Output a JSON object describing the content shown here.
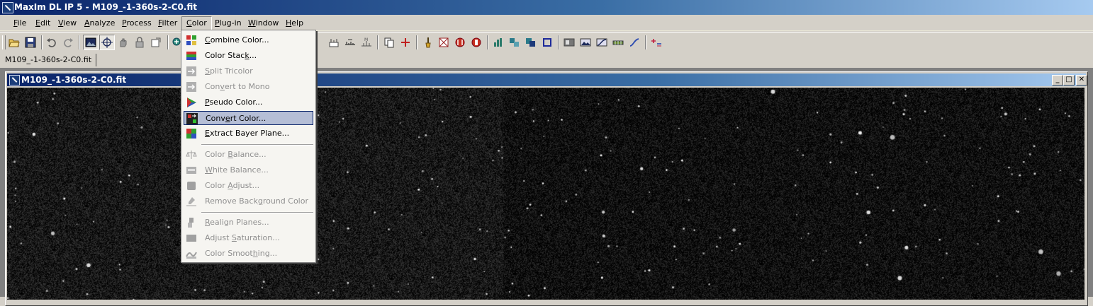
{
  "window": {
    "title": "MaxIm DL IP 5 - M109_-1-360s-2-C0.fit"
  },
  "menubar": [
    {
      "label": "File",
      "accel": "F",
      "rest": "ile"
    },
    {
      "label": "Edit",
      "accel": "E",
      "rest": "dit"
    },
    {
      "label": "View",
      "accel": "V",
      "rest": "iew"
    },
    {
      "label": "Analyze",
      "accel": "A",
      "rest": "nalyze"
    },
    {
      "label": "Process",
      "accel": "P",
      "rest": "rocess"
    },
    {
      "label": "Filter",
      "accel": "F",
      "rest": "ilter"
    },
    {
      "label": "Color",
      "accel": "C",
      "rest": "olor"
    },
    {
      "label": "Plug-in",
      "accel": "P",
      "rest": "lug-in"
    },
    {
      "label": "Window",
      "accel": "W",
      "rest": "indow"
    },
    {
      "label": "Help",
      "accel": "H",
      "rest": "elp"
    }
  ],
  "tabstrip": {
    "doc_tab": "M109_-1-360s-2-C0.fit"
  },
  "child_window": {
    "title": "M109_-1-360s-2-C0.fit",
    "min": "_",
    "max": "□",
    "close": "✕"
  },
  "color_menu": {
    "items": [
      {
        "pre": "",
        "accel": "C",
        "post": "ombine Color...",
        "enabled": true,
        "icon": "combine-color-icon"
      },
      {
        "pre": "Color Stac",
        "accel": "k",
        "post": "...",
        "enabled": true,
        "icon": "color-stack-icon"
      },
      {
        "pre": "",
        "accel": "S",
        "post": "plit Tricolor",
        "enabled": false,
        "icon": "split-tricolor-icon"
      },
      {
        "pre": "Con",
        "accel": "v",
        "post": "ert to Mono",
        "enabled": false,
        "icon": "convert-to-mono-icon"
      },
      {
        "pre": "",
        "accel": "P",
        "post": "seudo Color...",
        "enabled": true,
        "icon": "pseudo-color-icon"
      },
      {
        "pre": "Conv",
        "accel": "e",
        "post": "rt Color...",
        "enabled": true,
        "selected": true,
        "icon": "convert-color-icon"
      },
      {
        "pre": "",
        "accel": "E",
        "post": "xtract Bayer Plane...",
        "enabled": true,
        "icon": "extract-bayer-plane-icon"
      },
      {
        "pre": "Color ",
        "accel": "B",
        "post": "alance...",
        "enabled": false,
        "icon": "color-balance-icon"
      },
      {
        "pre": "",
        "accel": "W",
        "post": "hite Balance...",
        "enabled": false,
        "icon": "white-balance-icon"
      },
      {
        "pre": "Color ",
        "accel": "A",
        "post": "djust...",
        "enabled": false,
        "icon": "color-adjust-icon"
      },
      {
        "pre": "Remove Back",
        "accel": "g",
        "post": "round Color",
        "enabled": false,
        "icon": "remove-background-color-icon"
      },
      {
        "pre": "",
        "accel": "R",
        "post": "ealign Planes...",
        "enabled": false,
        "icon": "realign-planes-icon"
      },
      {
        "pre": "Adjust ",
        "accel": "S",
        "post": "aturation...",
        "enabled": false,
        "icon": "adjust-saturation-icon"
      },
      {
        "pre": "Color Smoot",
        "accel": "h",
        "post": "ing...",
        "enabled": false,
        "icon": "color-smoothing-icon"
      }
    ]
  },
  "colors": {
    "title_active": "#0a246a",
    "menu_highlight": "#b5bed6",
    "image_background": "#0b0b0b"
  }
}
